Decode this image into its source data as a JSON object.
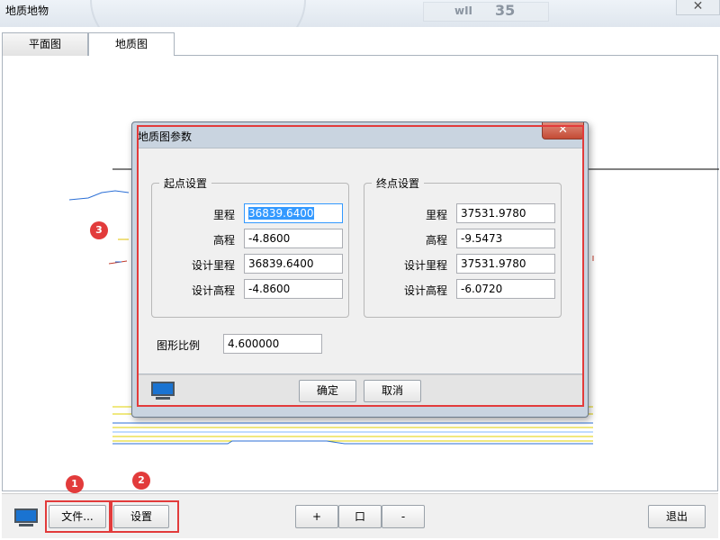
{
  "window": {
    "title": "地质地物",
    "close_symbol": "✕",
    "bg_text_1": "wII",
    "bg_text_2": "35"
  },
  "tabs": [
    {
      "label": "平面图",
      "active": false
    },
    {
      "label": "地质图",
      "active": true
    }
  ],
  "callouts": {
    "c1": "1",
    "c2": "2",
    "c3": "3"
  },
  "toolbar": {
    "file_label": "文件...",
    "settings_label": "设置",
    "zoom_in_label": "+",
    "fit_label": "口",
    "zoom_out_label": "-",
    "exit_label": "退出",
    "monitor_icon": "monitor-icon"
  },
  "dialog": {
    "title": "地质图参数",
    "close_symbol": "✕",
    "start_group": {
      "legend": "起点设置",
      "fields": [
        {
          "label": "里程",
          "value": "36839.6400",
          "selected": true
        },
        {
          "label": "高程",
          "value": "-4.8600"
        },
        {
          "label": "设计里程",
          "value": "36839.6400"
        },
        {
          "label": "设计高程",
          "value": "-4.8600"
        }
      ]
    },
    "end_group": {
      "legend": "终点设置",
      "fields": [
        {
          "label": "里程",
          "value": "37531.9780"
        },
        {
          "label": "高程",
          "value": "-9.5473"
        },
        {
          "label": "设计里程",
          "value": "37531.9780"
        },
        {
          "label": "设计高程",
          "value": "-6.0720"
        }
      ]
    },
    "scale_label": "图形比例",
    "scale_value": "4.600000",
    "ok_label": "确定",
    "cancel_label": "取消"
  },
  "colors": {
    "highlight": "#e23b3b",
    "accent_blue": "#1a73d1",
    "selection": "#3399ff"
  }
}
